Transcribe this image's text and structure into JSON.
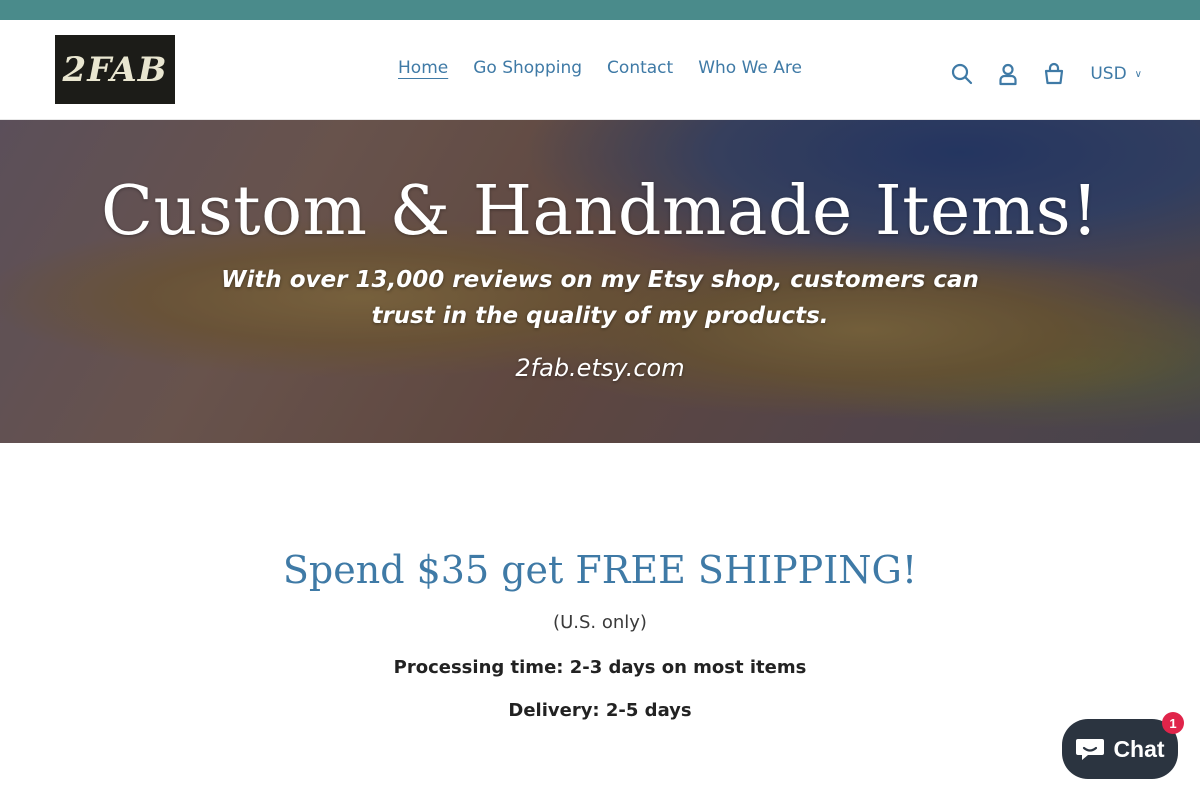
{
  "logo": {
    "text": "2FAB"
  },
  "nav": {
    "items": [
      {
        "label": "Home",
        "active": true
      },
      {
        "label": "Go Shopping",
        "active": false
      },
      {
        "label": "Contact",
        "active": false
      },
      {
        "label": "Who We Are",
        "active": false
      }
    ]
  },
  "header": {
    "icons": [
      "search-icon",
      "account-icon",
      "cart-icon"
    ],
    "currency": "USD"
  },
  "hero": {
    "title": "Custom & Handmade Items!",
    "subtitle": "With over 13,000 reviews on my Etsy shop, customers can trust in the quality of my products.",
    "link": "2fab.etsy.com"
  },
  "promo": {
    "title": "Spend $35 get FREE SHIPPING!",
    "note": "(U.S. only)",
    "processing": "Processing time: 2-3 days on most items",
    "delivery": "Delivery: 2-5 days"
  },
  "chat": {
    "label": "Chat",
    "badge": "1"
  },
  "colors": {
    "announcement": "#4a8b8b",
    "accent": "#3f7aa6",
    "chat_bg": "#2b3440",
    "badge": "#e0244a"
  }
}
